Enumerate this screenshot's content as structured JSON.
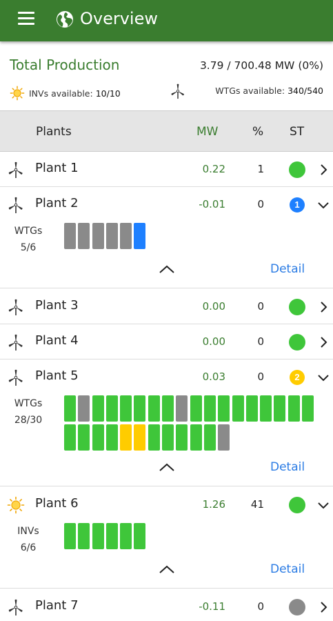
{
  "app": {
    "title": "Overview",
    "colors": {
      "primary": "#3a7d2f",
      "ok": "#3fc63a",
      "fault": "#8a8a8a",
      "warning": "#ffcc00",
      "alarm": "#1e80ff",
      "link": "#2a7be4"
    }
  },
  "summary": {
    "total_label": "Total Production",
    "total_value": "3.79 / 700.48 MW (0%)",
    "inv_label": "INVs available:",
    "inv_value": "10/10",
    "wtg_label": "WTGs available:",
    "wtg_value": "340/540"
  },
  "table": {
    "headers": {
      "plants": "Plants",
      "mw": "MW",
      "pct": "%",
      "st": "ST"
    }
  },
  "plants": [
    {
      "name": "Plant 1",
      "type": "wind",
      "mw": "0.22",
      "pct": "1",
      "status": "ok",
      "badge": "",
      "expanded": false
    },
    {
      "name": "Plant 2",
      "type": "wind",
      "mw": "-0.01",
      "pct": "0",
      "status": "alarm",
      "badge": "1",
      "expanded": true,
      "unit_label": "WTGs",
      "unit_count": "5/6",
      "units": [
        "fault",
        "fault",
        "fault",
        "fault",
        "fault",
        "alarm"
      ],
      "detail_label": "Detail"
    },
    {
      "name": "Plant 3",
      "type": "wind",
      "mw": "0.00",
      "pct": "0",
      "status": "ok",
      "badge": "",
      "expanded": false
    },
    {
      "name": "Plant 4",
      "type": "wind",
      "mw": "0.00",
      "pct": "0",
      "status": "ok",
      "badge": "",
      "expanded": false
    },
    {
      "name": "Plant 5",
      "type": "wind",
      "mw": "0.03",
      "pct": "0",
      "status": "warning",
      "badge": "2",
      "expanded": true,
      "unit_label": "WTGs",
      "unit_count": "28/30",
      "units": [
        "ok",
        "fault",
        "ok",
        "ok",
        "ok",
        "ok",
        "ok",
        "ok",
        "fault",
        "ok",
        "ok",
        "ok",
        "ok",
        "ok",
        "ok",
        "ok",
        "ok",
        "ok",
        "ok",
        "ok",
        "ok",
        "ok",
        "warning",
        "warning",
        "ok",
        "ok",
        "ok",
        "ok",
        "ok",
        "fault"
      ],
      "detail_label": "Detail"
    },
    {
      "name": "Plant 6",
      "type": "solar",
      "mw": "1.26",
      "pct": "41",
      "status": "ok",
      "badge": "",
      "expanded": true,
      "unit_label": "INVs",
      "unit_count": "6/6",
      "units": [
        "ok",
        "ok",
        "ok",
        "ok",
        "ok",
        "ok"
      ],
      "detail_label": "Detail"
    },
    {
      "name": "Plant 7",
      "type": "wind",
      "mw": "-0.11",
      "pct": "0",
      "status": "fault",
      "badge": "",
      "expanded": false
    }
  ]
}
